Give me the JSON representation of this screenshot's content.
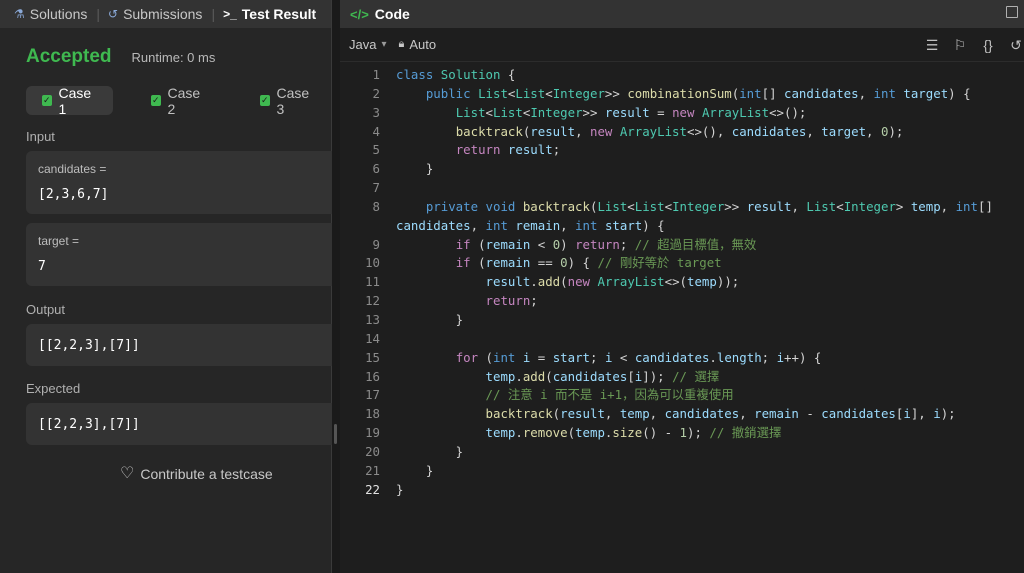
{
  "tabs": [
    {
      "label": "Solutions",
      "icon": "flask-icon"
    },
    {
      "label": "Submissions",
      "icon": "history-icon"
    },
    {
      "label": "Test Result",
      "icon": "terminal-icon"
    }
  ],
  "result": {
    "status": "Accepted",
    "runtime": "Runtime: 0 ms",
    "cases": [
      "Case 1",
      "Case 2",
      "Case 3"
    ],
    "input_label": "Input",
    "candidates_label": "candidates =",
    "candidates_value": "[2,3,6,7]",
    "target_label": "target =",
    "target_value": "7",
    "output_label": "Output",
    "output_value": "[[2,2,3],[7]]",
    "expected_label": "Expected",
    "expected_value": "[[2,2,3],[7]]",
    "contribute": "Contribute a testcase"
  },
  "code_panel": {
    "tab_label": "Code",
    "language": "Java",
    "mode": "Auto"
  },
  "colors": {
    "accent_green": "#3fb950",
    "panel_bg": "#262626",
    "editor_bg": "#1e1e1e"
  },
  "code_lines": [
    "class Solution {",
    "    public List<List<Integer>> combinationSum(int[] candidates, int target) {",
    "        List<List<Integer>> result = new ArrayList<>();",
    "        backtrack(result, new ArrayList<>(), candidates, target, 0);",
    "        return result;",
    "    }",
    "",
    "    private void backtrack(List<List<Integer>> result, List<Integer> temp, int[] candidates, int remain, int start) {",
    "        if (remain < 0) return; // 超過目標值，無效",
    "        if (remain == 0) { // 剛好等於 target",
    "            result.add(new ArrayList<>(temp));",
    "            return;",
    "        }",
    "",
    "        for (int i = start; i < candidates.length; i++) {",
    "            temp.add(candidates[i]); // 選擇",
    "            // 注意 i 而不是 i+1，因為可以重複使用",
    "            backtrack(result, temp, candidates, remain - candidates[i], i);",
    "            temp.remove(temp.size() - 1); // 撤銷選擇",
    "        }",
    "    }",
    "}"
  ]
}
